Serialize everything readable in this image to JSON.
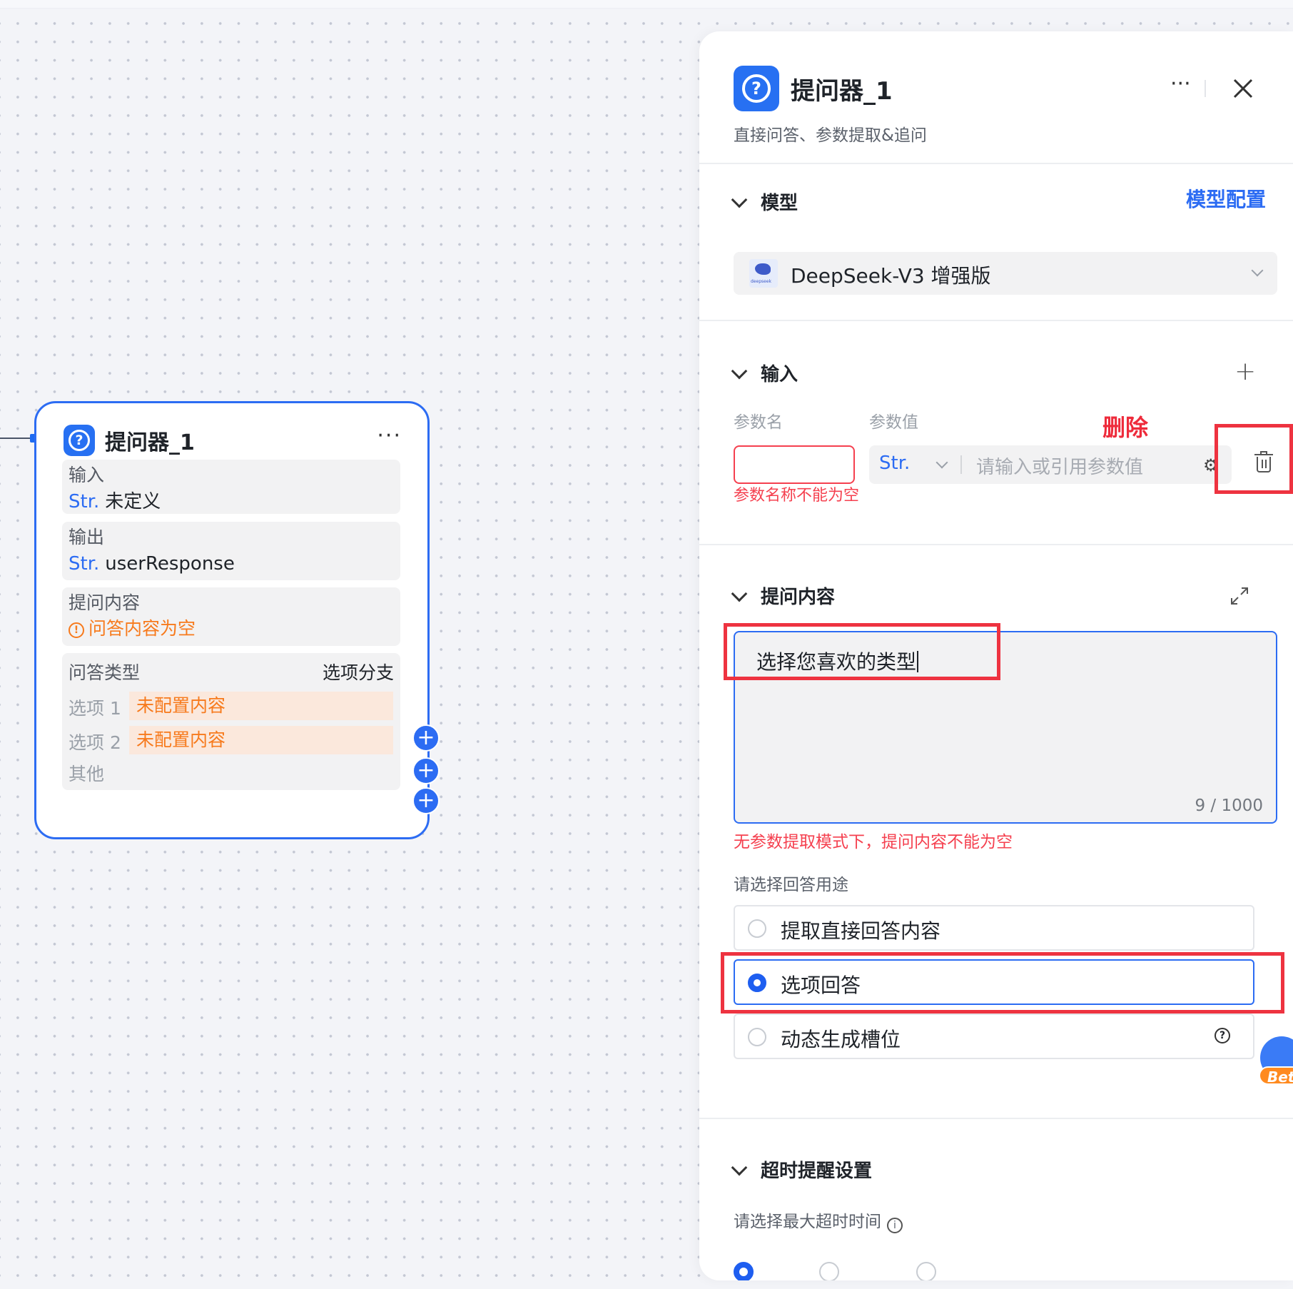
{
  "node": {
    "title": "提问器_1",
    "more": "···",
    "input_label": "输入",
    "input_type": "Str.",
    "input_value": "未定义",
    "output_label": "输出",
    "output_type": "Str.",
    "output_value": "userResponse",
    "question_label": "提问内容",
    "question_warning": "问答内容为空",
    "qa_type_label": "问答类型",
    "qa_type_value": "选项分支",
    "options": [
      {
        "label": "选项 1",
        "value": "未配置内容"
      },
      {
        "label": "选项 2",
        "value": "未配置内容"
      }
    ],
    "other_label": "其他",
    "plus": "+"
  },
  "panel": {
    "title": "提问器_1",
    "subtitle": "直接问答、参数提取&追问",
    "more": "···",
    "model_section": "模型",
    "model_config_link": "模型配置",
    "model_logo_text": "deepseek",
    "model_name": "DeepSeek-V3 增强版",
    "input_section": "输入",
    "add": "+",
    "param_name_col": "参数名",
    "param_value_col": "参数值",
    "delete_annotation": "删除",
    "param_name_error": "参数名称不能为空",
    "param_type": "Str.",
    "param_value_placeholder": "请输入或引用参数值",
    "gear": "⚙",
    "question_section": "提问内容",
    "question_text": "选择您喜欢的类型",
    "question_count": "9 / 1000",
    "question_error": "无参数提取模式下，提问内容不能为空",
    "answer_usage_label": "请选择回答用途",
    "answer_options": [
      {
        "label": "提取直接回答内容",
        "selected": false
      },
      {
        "label": "选项回答",
        "selected": true
      },
      {
        "label": "动态生成槽位",
        "selected": false
      }
    ],
    "help": "?",
    "timeout_section": "超时提醒设置",
    "timeout_label": "请选择最大超时时间",
    "info": "i",
    "beta": "Bet"
  },
  "colors": {
    "accent": "#2c6cf3",
    "error": "#f5404f",
    "warning": "#f77a1c",
    "annotation": "#ee3340"
  }
}
